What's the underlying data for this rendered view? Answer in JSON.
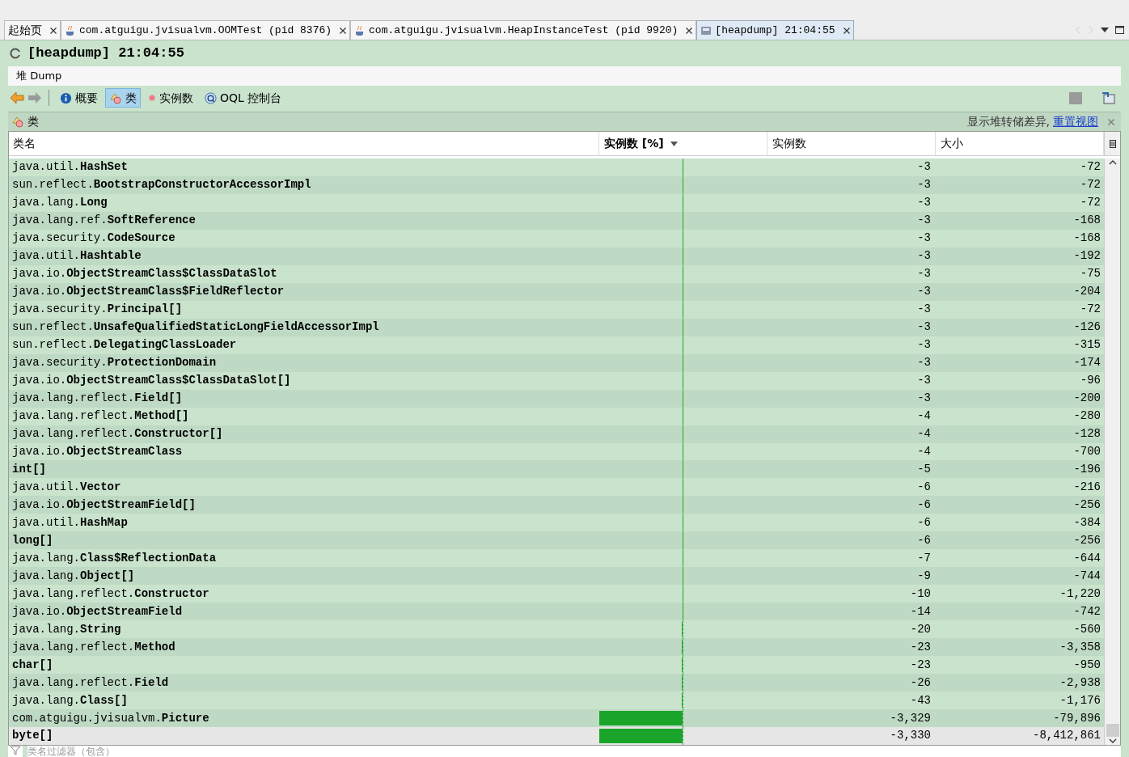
{
  "tabs": [
    {
      "label": "起始页",
      "kind": "start",
      "selected": false
    },
    {
      "label": "com.atguigu.jvisualvm.OOMTest (pid 8376)",
      "kind": "app",
      "selected": false
    },
    {
      "label": "com.atguigu.jvisualvm.HeapInstanceTest (pid 9920)",
      "kind": "app",
      "selected": false
    },
    {
      "label": "[heapdump] 21:04:55",
      "kind": "heapdump",
      "selected": true
    }
  ],
  "title": "[heapdump] 21:04:55",
  "subtitle": "堆 Dump",
  "toolbar": [
    {
      "label": "概要",
      "kind": "info",
      "selected": false
    },
    {
      "label": "类",
      "kind": "classes",
      "selected": true
    },
    {
      "label": "实例数",
      "kind": "instances",
      "selected": false
    },
    {
      "label": "OQL 控制台",
      "kind": "oql",
      "selected": false
    }
  ],
  "section": {
    "title": "类",
    "hint": "显示堆转储差异,",
    "link": "重置视图"
  },
  "table": {
    "columns": [
      "类名",
      "实例数 [%]",
      "实例数",
      "大小"
    ],
    "rows": [
      {
        "name": "java.util.**HashSet**",
        "level": 0.001,
        "count": "-3",
        "size": "-72",
        "selected": false
      },
      {
        "name": "sun.reflect.**BootstrapConstructorAccessorImpl**",
        "level": 0.001,
        "count": "-3",
        "size": "-72",
        "selected": false
      },
      {
        "name": "java.lang.**Long**",
        "level": 0.001,
        "count": "-3",
        "size": "-72",
        "selected": false
      },
      {
        "name": "java.lang.ref.**SoftReference**",
        "level": 0.001,
        "count": "-3",
        "size": "-168",
        "selected": false
      },
      {
        "name": "java.security.**CodeSource**",
        "level": 0.001,
        "count": "-3",
        "size": "-168",
        "selected": false
      },
      {
        "name": "java.util.**Hashtable**",
        "level": 0.001,
        "count": "-3",
        "size": "-192",
        "selected": false
      },
      {
        "name": "java.io.**ObjectStreamClass$ClassDataSlot**",
        "level": 0.001,
        "count": "-3",
        "size": "-75",
        "selected": false
      },
      {
        "name": "java.io.**ObjectStreamClass$FieldReflector**",
        "level": 0.001,
        "count": "-3",
        "size": "-204",
        "selected": false
      },
      {
        "name": "java.security.**Principal[]**",
        "level": 0.001,
        "count": "-3",
        "size": "-72",
        "selected": false
      },
      {
        "name": "sun.reflect.**UnsafeQualifiedStaticLongFieldAccessorImpl**",
        "level": 0.001,
        "count": "-3",
        "size": "-126",
        "selected": false
      },
      {
        "name": "sun.reflect.**DelegatingClassLoader**",
        "level": 0.001,
        "count": "-3",
        "size": "-315",
        "selected": false
      },
      {
        "name": "java.security.**ProtectionDomain**",
        "level": 0.001,
        "count": "-3",
        "size": "-174",
        "selected": false
      },
      {
        "name": "java.io.**ObjectStreamClass$ClassDataSlot[]**",
        "level": 0.001,
        "count": "-3",
        "size": "-96",
        "selected": false
      },
      {
        "name": "java.lang.reflect.**Field[]**",
        "level": 0.001,
        "count": "-3",
        "size": "-200",
        "selected": false
      },
      {
        "name": "java.lang.reflect.**Method[]**",
        "level": 0.001,
        "count": "-4",
        "size": "-280",
        "selected": false
      },
      {
        "name": "java.lang.reflect.**Constructor[]**",
        "level": 0.001,
        "count": "-4",
        "size": "-128",
        "selected": false
      },
      {
        "name": "java.io.**ObjectStreamClass**",
        "level": 0.001,
        "count": "-4",
        "size": "-700",
        "selected": false
      },
      {
        "name": "**int[]**",
        "level": 0.002,
        "count": "-5",
        "size": "-196",
        "selected": false
      },
      {
        "name": "java.util.**Vector**",
        "level": 0.002,
        "count": "-6",
        "size": "-216",
        "selected": false
      },
      {
        "name": "java.io.**ObjectStreamField[]**",
        "level": 0.002,
        "count": "-6",
        "size": "-256",
        "selected": false
      },
      {
        "name": "java.util.**HashMap**",
        "level": 0.002,
        "count": "-6",
        "size": "-384",
        "selected": false
      },
      {
        "name": "**long[]**",
        "level": 0.002,
        "count": "-6",
        "size": "-256",
        "selected": false
      },
      {
        "name": "java.lang.**Class$ReflectionData**",
        "level": 0.002,
        "count": "-7",
        "size": "-644",
        "selected": false
      },
      {
        "name": "java.lang.**Object[]**",
        "level": 0.003,
        "count": "-9",
        "size": "-744",
        "selected": false
      },
      {
        "name": "java.lang.reflect.**Constructor**",
        "level": 0.003,
        "count": "-10",
        "size": "-1,220",
        "selected": false
      },
      {
        "name": "java.io.**ObjectStreamField**",
        "level": 0.004,
        "count": "-14",
        "size": "-742",
        "selected": false
      },
      {
        "name": "java.lang.**String**",
        "level": 0.006,
        "count": "-20",
        "size": "-560",
        "selected": false
      },
      {
        "name": "java.lang.reflect.**Method**",
        "level": 0.007,
        "count": "-23",
        "size": "-3,358",
        "selected": false
      },
      {
        "name": "**char[]**",
        "level": 0.007,
        "count": "-23",
        "size": "-950",
        "selected": false
      },
      {
        "name": "java.lang.reflect.**Field**",
        "level": 0.008,
        "count": "-26",
        "size": "-2,938",
        "selected": false
      },
      {
        "name": "java.lang.**Class[]**",
        "level": 0.013,
        "count": "-43",
        "size": "-1,176",
        "selected": false
      },
      {
        "name": "com.atguigu.jvisualvm.**Picture**",
        "level": 1.0,
        "count": "-3,329",
        "size": "-79,896",
        "selected": false
      },
      {
        "name": "**byte[]**",
        "level": 1.0,
        "count": "-3,330",
        "size": "-8,412,861",
        "selected": true
      }
    ]
  },
  "filter": {
    "placeholder": "类名过滤器（包含）"
  }
}
